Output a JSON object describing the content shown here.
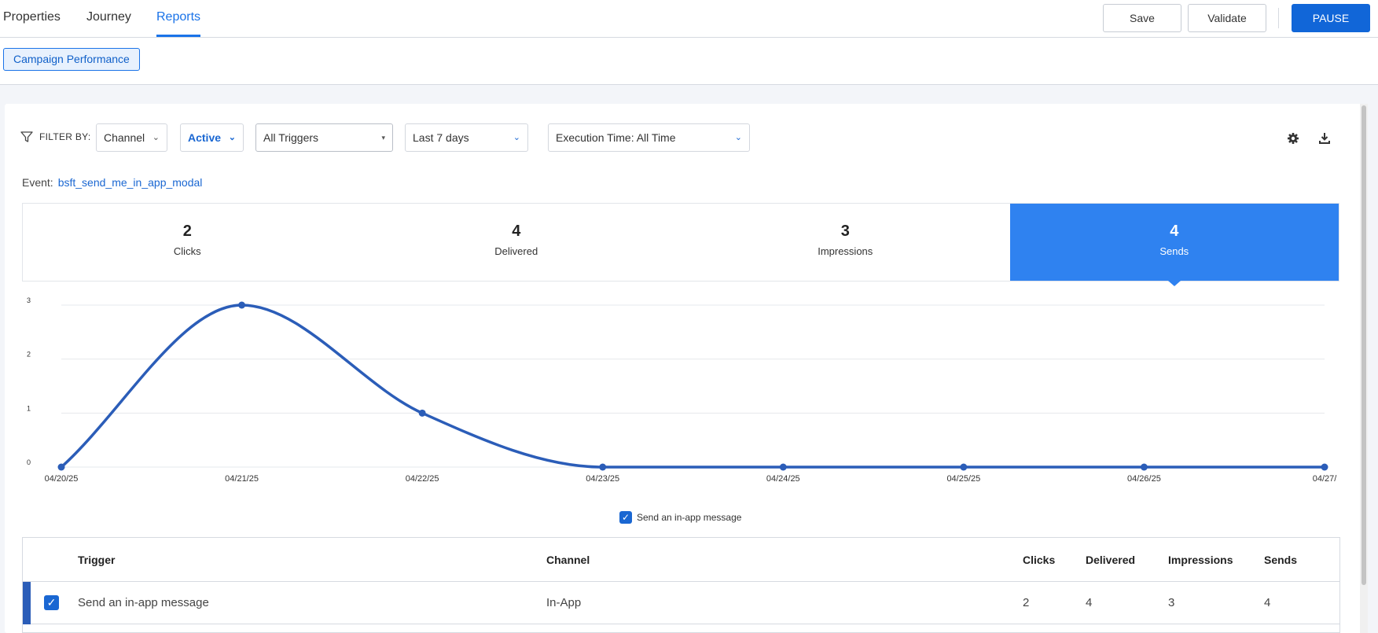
{
  "tabs": [
    {
      "label": "Properties",
      "active": false
    },
    {
      "label": "Journey",
      "active": false
    },
    {
      "label": "Reports",
      "active": true
    }
  ],
  "actions": {
    "save": "Save",
    "validate": "Validate",
    "pause": "PAUSE"
  },
  "subtab": "Campaign Performance",
  "filters": {
    "label": "FILTER BY:",
    "channel": "Channel",
    "status": "Active",
    "triggers": "All Triggers",
    "range": "Last 7 days",
    "execution": "Execution Time: All Time"
  },
  "event": {
    "label": "Event:",
    "name": "bsft_send_me_in_app_modal"
  },
  "stats": [
    {
      "value": "2",
      "label": "Clicks",
      "active": false
    },
    {
      "value": "4",
      "label": "Delivered",
      "active": false
    },
    {
      "value": "3",
      "label": "Impressions",
      "active": false
    },
    {
      "value": "4",
      "label": "Sends",
      "active": true
    }
  ],
  "chart_data": {
    "type": "line",
    "x": [
      "04/20/25",
      "04/21/25",
      "04/22/25",
      "04/23/25",
      "04/24/25",
      "04/25/25",
      "04/26/25",
      "04/27/"
    ],
    "series": [
      {
        "name": "Send an in-app message",
        "values": [
          0,
          3,
          1,
          0,
          0,
          0,
          0,
          0
        ]
      }
    ],
    "yticks": [
      "0",
      "1",
      "2",
      "3"
    ],
    "ylim": [
      0,
      3
    ],
    "grid": true,
    "smooth": true,
    "color": "#2b5db8"
  },
  "legend": {
    "label": "Send an in-app message",
    "checked": true
  },
  "table": {
    "headers": [
      "Trigger",
      "Channel",
      "Clicks",
      "Delivered",
      "Impressions",
      "Sends"
    ],
    "rows": [
      {
        "trigger": "Send an in-app message",
        "channel": "In-App",
        "clicks": "2",
        "delivered": "4",
        "impressions": "3",
        "sends": "4",
        "checked": true
      }
    ]
  },
  "colors": {
    "accent": "#1a73e8",
    "primary_button": "#1166d8",
    "active_stat": "#2f82f0",
    "series": "#2b5db8"
  }
}
